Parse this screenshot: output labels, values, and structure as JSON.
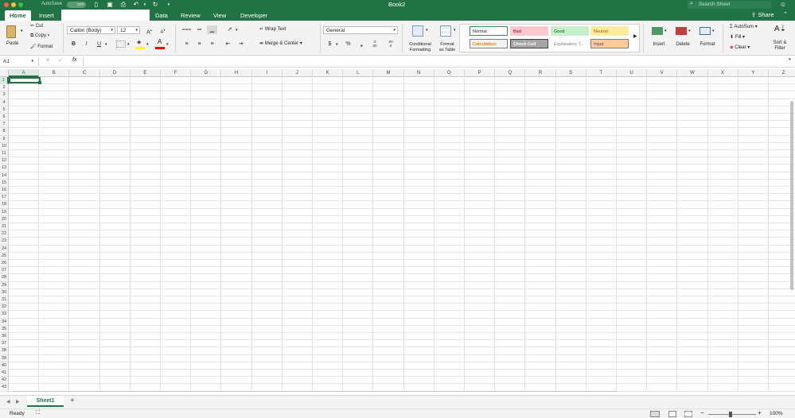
{
  "window": {
    "title": "Book2",
    "autosave_label": "AutoSave",
    "autosave_state": "OFF",
    "search_placeholder": "Search Sheet"
  },
  "tabs": [
    {
      "label": "Home",
      "active": true
    },
    {
      "label": "Insert"
    },
    {
      "label": "Data"
    },
    {
      "label": "Review"
    },
    {
      "label": "View"
    },
    {
      "label": "Developer"
    }
  ],
  "share_label": "Share",
  "clipboard": {
    "paste": "Paste",
    "cut": "Cut",
    "copy": "Copy",
    "format": "Format"
  },
  "font": {
    "name": "Calibri (Body)",
    "size": "12",
    "bold": "B",
    "italic": "I",
    "underline": "U",
    "color_letter": "A"
  },
  "alignment": {
    "wrap": "Wrap Text",
    "merge": "Merge & Center"
  },
  "number": {
    "format": "General",
    "currency": "$",
    "percent": "%",
    "comma": "➔"
  },
  "styles_group": {
    "conditional": "Conditional Formatting",
    "conditional_l1": "Conditional",
    "conditional_l2": "Formatting",
    "format_table_l1": "Format",
    "format_table_l2": "as Table",
    "cells": [
      {
        "label": "Normal",
        "bg": "#ffffff",
        "fg": "#222222",
        "border": "#3b8a5a"
      },
      {
        "label": "Bad",
        "bg": "#ffc7ce",
        "fg": "#9c0006",
        "border": "#ffc7ce"
      },
      {
        "label": "Good",
        "bg": "#c6efce",
        "fg": "#006100",
        "border": "#c6efce"
      },
      {
        "label": "Neutral",
        "bg": "#ffeb9c",
        "fg": "#9c5700",
        "border": "#ffeb9c"
      },
      {
        "label": "Calculation",
        "bg": "#f2f2f2",
        "fg": "#fa7d00",
        "border": "#7f7f7f"
      },
      {
        "label": "Check Cell",
        "bg": "#a5a5a5",
        "fg": "#ffffff",
        "border": "#3f3f3f"
      },
      {
        "label": "Explanatory T...",
        "bg": "#ffffff",
        "fg": "#7f7f7f",
        "border": "#ffffff"
      },
      {
        "label": "Input",
        "bg": "#ffcc99",
        "fg": "#3f3f76",
        "border": "#7f7f7f"
      }
    ]
  },
  "cells_group": {
    "insert": "Insert",
    "delete": "Delete",
    "format": "Format"
  },
  "editing": {
    "autosum": "AutoSum",
    "fill": "Fill",
    "clear": "Clear",
    "sort_l1": "Sort &",
    "sort_l2": "Filter"
  },
  "formula_bar": {
    "name_box": "A1",
    "fx": "fx",
    "value": ""
  },
  "grid": {
    "columns": [
      "A",
      "B",
      "C",
      "D",
      "E",
      "F",
      "G",
      "H",
      "I",
      "J",
      "K",
      "L",
      "M",
      "N",
      "O",
      "P",
      "Q",
      "R",
      "S",
      "T",
      "U",
      "V",
      "W",
      "X",
      "Y",
      "Z"
    ],
    "rows": [
      "1",
      "2",
      "3",
      "4",
      "5",
      "6",
      "7",
      "8",
      "9",
      "10",
      "11",
      "12",
      "13",
      "14",
      "15",
      "16",
      "17",
      "18",
      "19",
      "20",
      "21",
      "22",
      "23",
      "24",
      "25",
      "26",
      "27",
      "28",
      "29",
      "30",
      "31",
      "32",
      "33",
      "34",
      "35",
      "36",
      "37",
      "38",
      "39",
      "40",
      "41",
      "42",
      "43"
    ],
    "selected_cell": "A1"
  },
  "sheets": [
    {
      "label": "Sheet1",
      "active": true
    }
  ],
  "add_sheet": "+",
  "status": {
    "text": "Ready",
    "zoom": "100%"
  },
  "colors": {
    "brand": "#217346",
    "selection": "#217346"
  }
}
